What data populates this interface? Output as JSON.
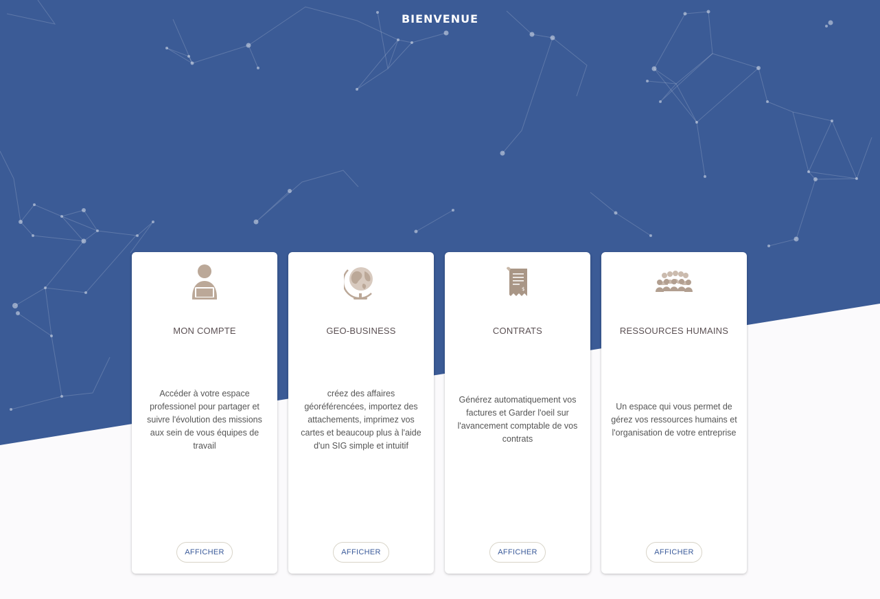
{
  "header": {
    "title": "BIENVENUE"
  },
  "colors": {
    "hero": "#3b5b96",
    "icon": "#bba898",
    "bottom": "#fbfafc"
  },
  "cards": [
    {
      "icon": "user-laptop-icon",
      "title": "MON COMPTE",
      "description": "Accéder à votre espace professionel pour partager et suivre l'évolution des missions aux sein de vous équipes de travail",
      "button_label": "AFFICHER"
    },
    {
      "icon": "globe-icon",
      "title": "GEO-BUSINESS",
      "description": "créez des affaires géoréférencées, importez des attachements, imprimez vos cartes et beaucoup plus à l'aide d'un SIG simple et intuitif",
      "button_label": "AFFICHER"
    },
    {
      "icon": "invoice-receipt-icon",
      "title": "CONTRATS",
      "description": "Générez automatiquement vos factures et Garder l'oeil sur l'avancement comptable de vos contrats",
      "button_label": "AFFICHER"
    },
    {
      "icon": "people-group-icon",
      "title": "RESSOURCES HUMAINS",
      "description": "Un espace qui vous permet de gérez vos ressources humains et l'organisation de votre entreprise",
      "button_label": "AFFICHER"
    }
  ]
}
